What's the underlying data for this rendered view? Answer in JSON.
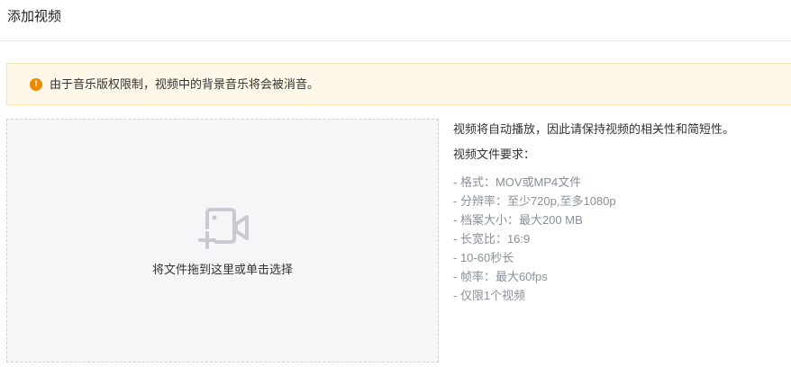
{
  "header": {
    "title": "添加视频"
  },
  "notice": {
    "icon": "warning-info-icon",
    "color": "#ed8a00",
    "text": "由于音乐版权限制，视频中的背景音乐将会被消音。"
  },
  "dropzone": {
    "icon": "add-video-camera-icon",
    "label": "将文件拖到这里或单击选择"
  },
  "requirements": {
    "intro": "视频将自动播放，因此请保持视频的相关性和简短性。",
    "heading": "视频文件要求：",
    "items": [
      "- 格式：MOV或MP4文件",
      "- 分辨率：至少720p,至多1080p",
      "- 档案大小：最大200 MB",
      "- 长宽比：16:9",
      "- 10-60秒长",
      "- 帧率：最大60fps",
      "- 仅限1个视频"
    ]
  }
}
